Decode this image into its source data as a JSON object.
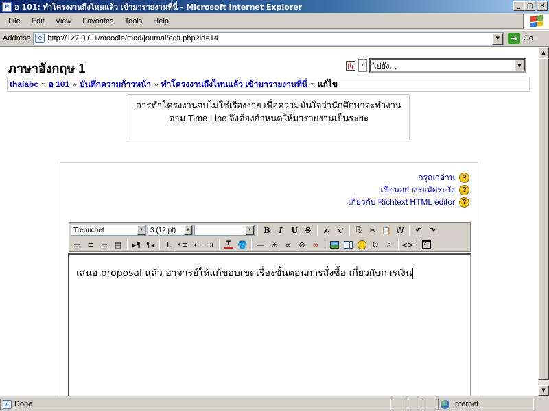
{
  "window": {
    "title": "อ 101: ทำโครงงานถึงไหนแล้ว เข้ามารายงานที่นี่ - Microsoft Internet Explorer",
    "app_icon": "ie-icon",
    "controls": [
      "_",
      "▢",
      "✕"
    ]
  },
  "menu": {
    "items": [
      "File",
      "Edit",
      "View",
      "Favorites",
      "Tools",
      "Help"
    ]
  },
  "address": {
    "label": "Address",
    "url": "http://127.0.0.1/moodle/mod/journal/edit.php?id=14",
    "go_label": "Go"
  },
  "page": {
    "course_title": "ภาษาอังกฤษ 1",
    "jump_select": "ไปยัง...",
    "breadcrumb": [
      "thaiabc",
      "อ 101",
      "บันทึกความก้าวหน้า",
      "ทำโครงงานถึงไหนแล้ว เข้ามารายงานที่นี่",
      "แก้ไข"
    ],
    "breadcrumb_sep": "»",
    "intro_text": "การทำโครงงานจบไม่ใช่เรื่องง่าย เพื่อความมั่นใจว่านักศึกษาจะทำงานตาม Time Line จึงต้องกำหนดให้มารายงานเป็นระยะ",
    "help_links": [
      "กรุณาอ่าน",
      "เขียนอย่างระมัดระวัง",
      "เกี่ยวกับ Richtext HTML editor"
    ],
    "help_icon_label": "?"
  },
  "editor": {
    "font_family": "Trebuchet",
    "font_size": "3 (12 pt)",
    "style": "",
    "content": "เสนอ proposal แล้ว อาจารย์ให้แก้ขอบเขตเรื่องขั้นตอนการสั่งซื้อ เกี่ยวกับการเงิน"
  },
  "status": {
    "text": "Done",
    "zone": "Internet"
  },
  "colors": {
    "titlebar": "#0a246a",
    "link": "#0000cc",
    "chrome": "#d4d0c8"
  }
}
